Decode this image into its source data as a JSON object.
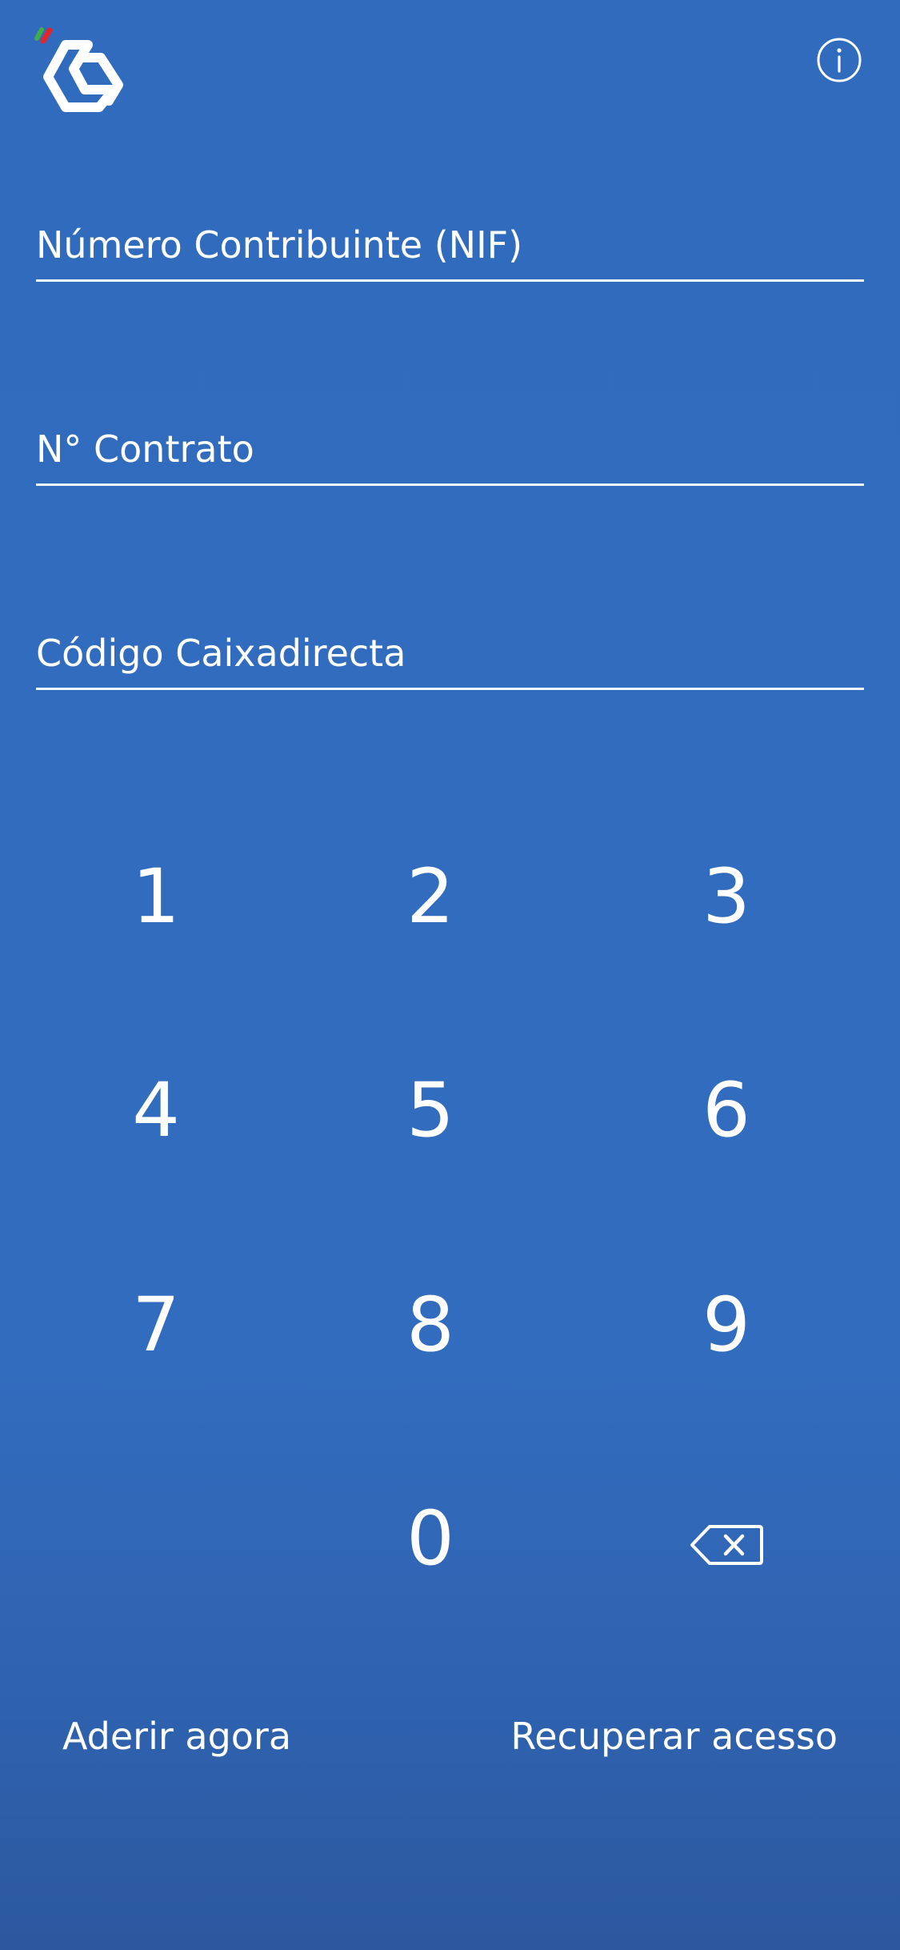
{
  "header": {
    "logo_icon": "cgd-logo",
    "info_icon": "info-icon"
  },
  "form": {
    "nif": {
      "placeholder": "Número Contribuinte (NIF)",
      "value": ""
    },
    "contrato": {
      "placeholder": "N° Contrato",
      "value": ""
    },
    "codigo": {
      "placeholder": "Código Caixadirecta",
      "value": ""
    }
  },
  "keypad": {
    "k1": "1",
    "k2": "2",
    "k3": "3",
    "k4": "4",
    "k5": "5",
    "k6": "6",
    "k7": "7",
    "k8": "8",
    "k9": "9",
    "k0": "0",
    "backspace_icon": "backspace-icon"
  },
  "footer": {
    "join_label": "Aderir agora",
    "recover_label": "Recuperar acesso"
  },
  "colors": {
    "background": "#316bbd",
    "foreground": "#ffffff",
    "accent_green": "#3fae49",
    "accent_red": "#e0262b"
  }
}
